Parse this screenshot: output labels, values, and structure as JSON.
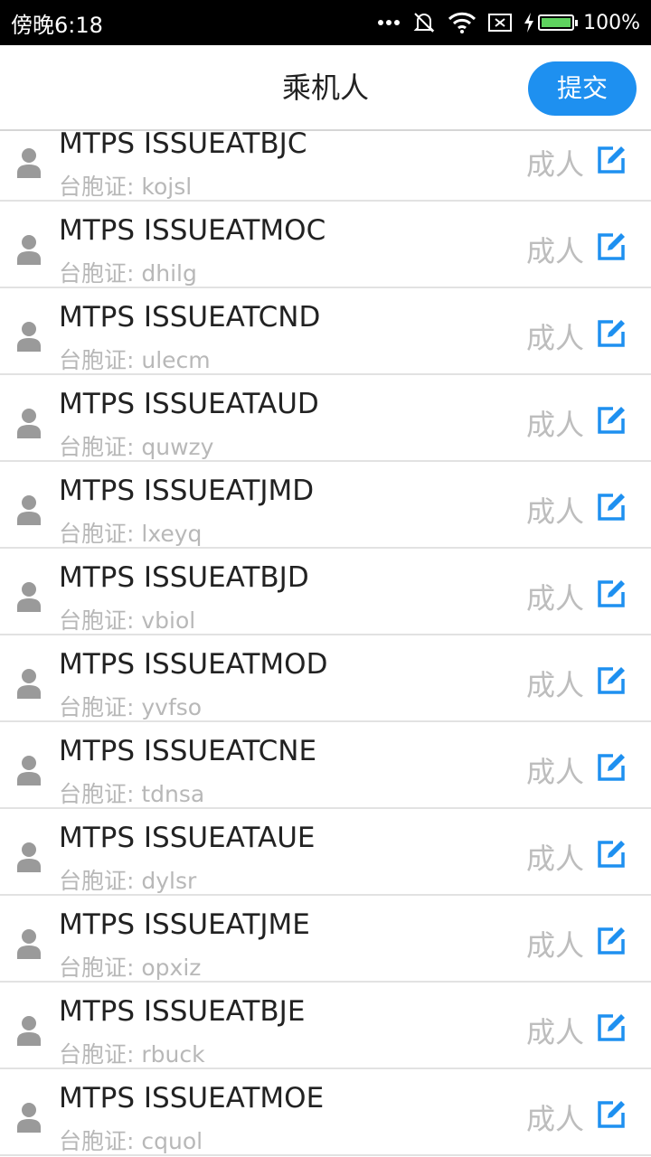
{
  "status_bar": {
    "time": "傍晚6:18",
    "battery": "100%"
  },
  "header": {
    "title": "乘机人",
    "submit_label": "提交"
  },
  "accent_color": "#1e90f0",
  "passengers": [
    {
      "name": "MTPS ISSUEATBJC",
      "doc": "台胞证: kojsl",
      "type": "成人"
    },
    {
      "name": "MTPS ISSUEATMOC",
      "doc": "台胞证: dhilg",
      "type": "成人"
    },
    {
      "name": "MTPS ISSUEATCND",
      "doc": "台胞证: ulecm",
      "type": "成人"
    },
    {
      "name": "MTPS ISSUEATAUD",
      "doc": "台胞证: quwzy",
      "type": "成人"
    },
    {
      "name": "MTPS ISSUEATJMD",
      "doc": "台胞证: lxeyq",
      "type": "成人"
    },
    {
      "name": "MTPS ISSUEATBJD",
      "doc": "台胞证: vbiol",
      "type": "成人"
    },
    {
      "name": "MTPS ISSUEATMOD",
      "doc": "台胞证: yvfso",
      "type": "成人"
    },
    {
      "name": "MTPS ISSUEATCNE",
      "doc": "台胞证: tdnsa",
      "type": "成人"
    },
    {
      "name": "MTPS ISSUEATAUE",
      "doc": "台胞证: dylsr",
      "type": "成人"
    },
    {
      "name": "MTPS ISSUEATJME",
      "doc": "台胞证: opxiz",
      "type": "成人"
    },
    {
      "name": "MTPS ISSUEATBJE",
      "doc": "台胞证: rbuck",
      "type": "成人"
    },
    {
      "name": "MTPS ISSUEATMOE",
      "doc": "台胞证: cquol",
      "type": "成人"
    }
  ]
}
